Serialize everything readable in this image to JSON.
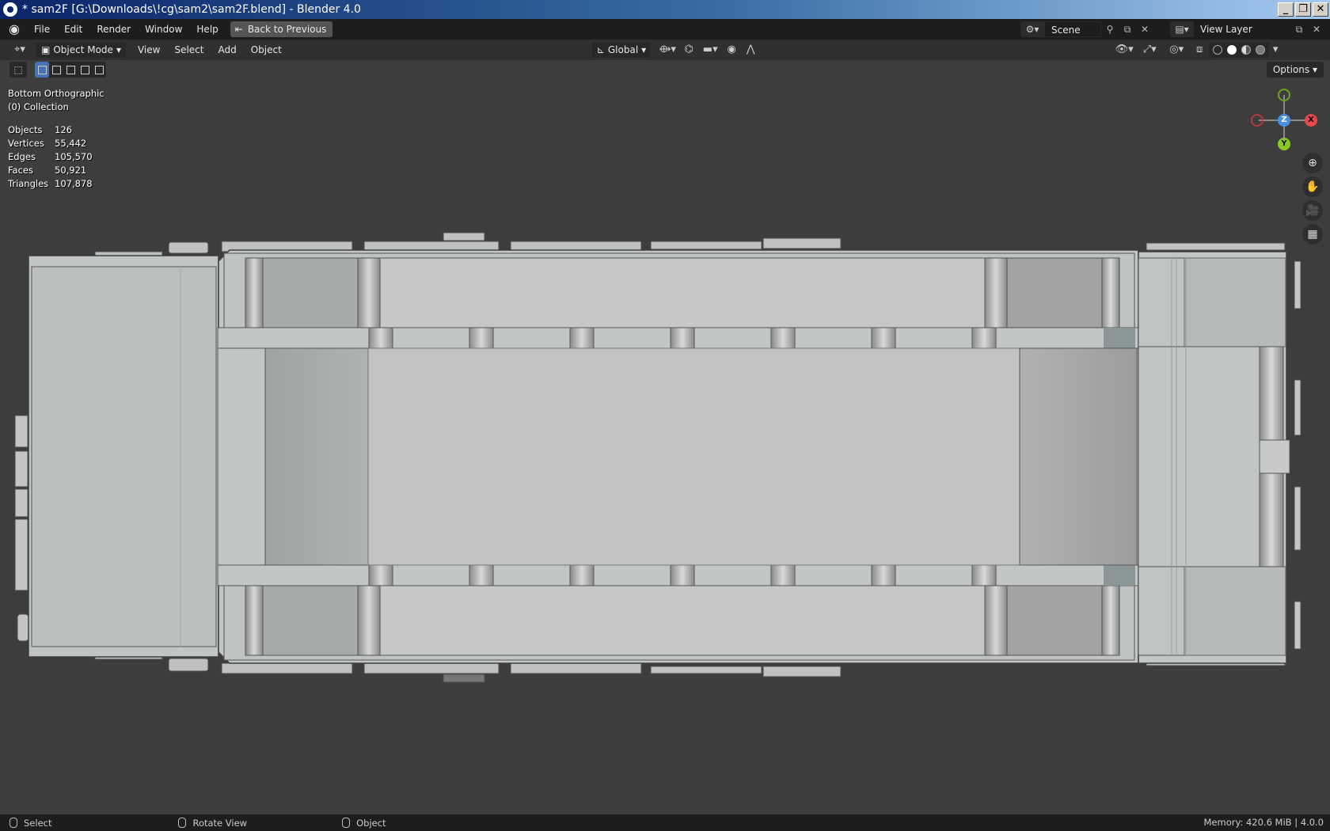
{
  "window": {
    "title": "* sam2F [G:\\Downloads\\!cg\\sam2\\sam2F.blend] - Blender 4.0",
    "buttons": [
      "_",
      "❐",
      "✕"
    ]
  },
  "menubar": {
    "items": [
      "File",
      "Edit",
      "Render",
      "Window",
      "Help"
    ],
    "back_label": "Back to Previous",
    "scene": "Scene",
    "view_layer": "View Layer"
  },
  "viewport_header": {
    "mode": "Object Mode",
    "menus": [
      "View",
      "Select",
      "Add",
      "Object"
    ],
    "transform_orientation": "Global"
  },
  "toolrow": {
    "options_label": "Options"
  },
  "overlay": {
    "view_name": "Bottom Orthographic",
    "collection": "(0) Collection"
  },
  "stats": [
    {
      "label": "Objects",
      "value": "126"
    },
    {
      "label": "Vertices",
      "value": "55,442"
    },
    {
      "label": "Edges",
      "value": "105,570"
    },
    {
      "label": "Faces",
      "value": "50,921"
    },
    {
      "label": "Triangles",
      "value": "107,878"
    }
  ],
  "gizmo": {
    "x_label": "X",
    "y_label": "Y",
    "z_label": "Z",
    "colors": {
      "x": "#e5484d",
      "y": "#8ac926",
      "z": "#4a90e2"
    }
  },
  "statusbar": {
    "select": "Select",
    "rotate": "Rotate View",
    "object": "Object",
    "memory": "Memory: 420.6 MiB | 4.0.0"
  }
}
